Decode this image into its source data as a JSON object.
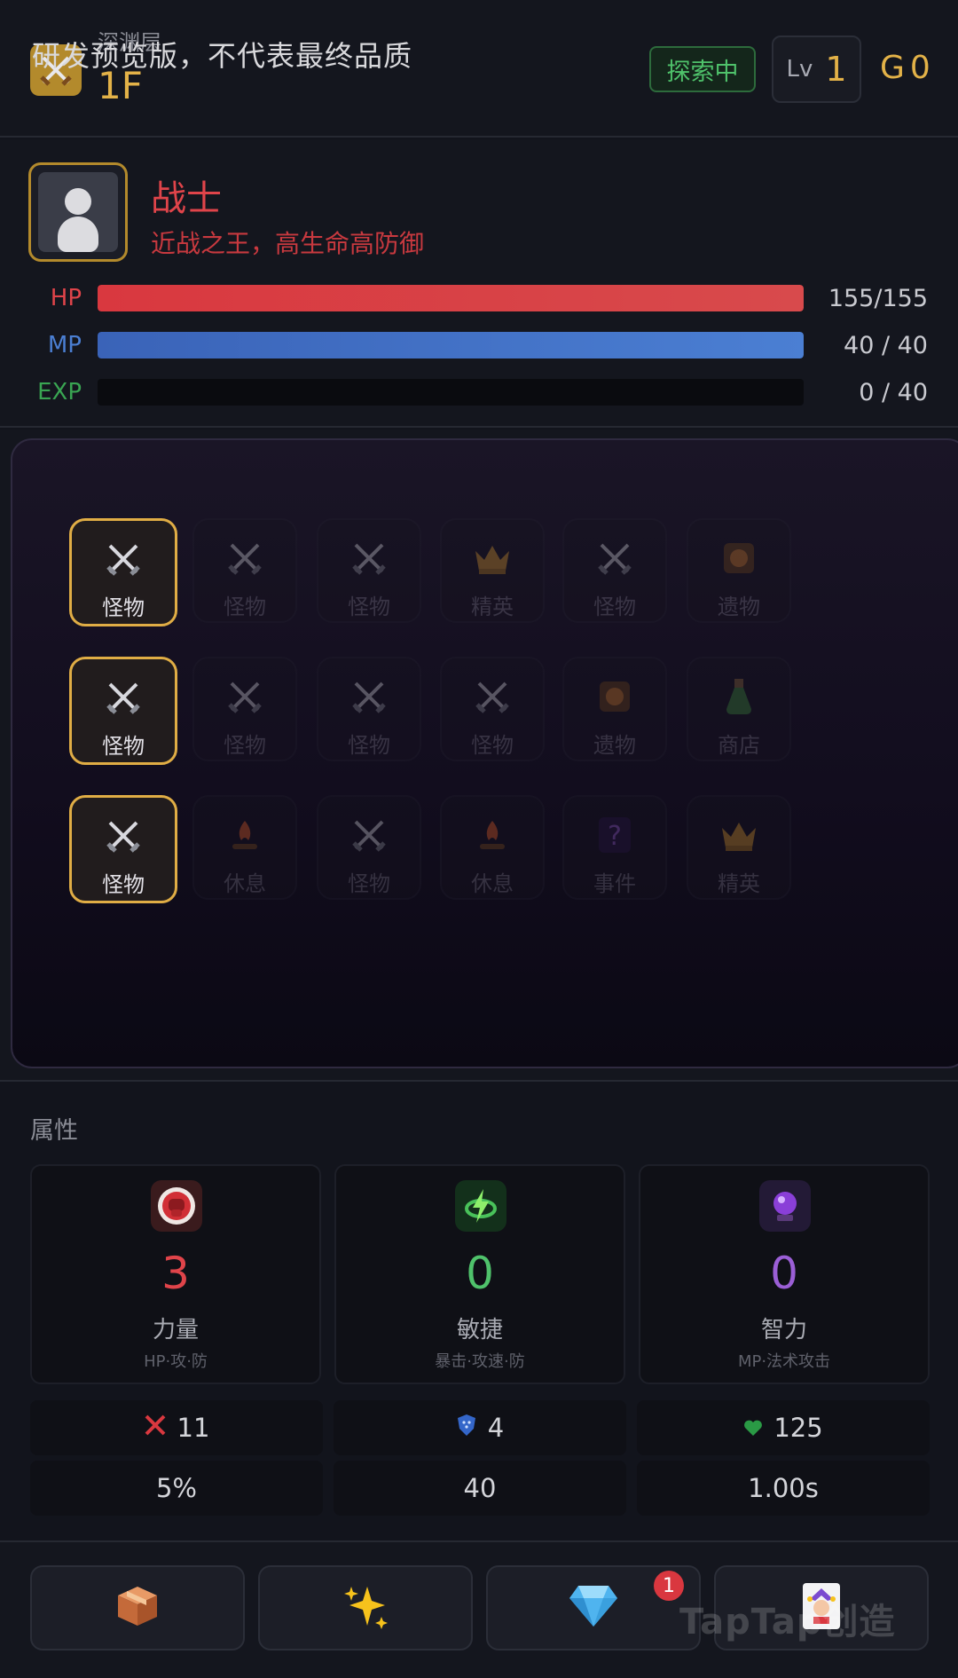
{
  "header": {
    "watermark": "研发预览版，不代表最终品质",
    "floor_sub_label": "深渊层",
    "floor_value": "1F",
    "status_badge": "探索中",
    "level_label": "Lv",
    "level_value": "1",
    "gold_label": "G",
    "gold_value": "0"
  },
  "character": {
    "class_name": "战士",
    "description": "近战之王，高生命高防御",
    "stats": [
      {
        "label": "HP",
        "value_text": "155/155",
        "current": 155,
        "max": 155,
        "color": "#d9383f",
        "color_end": "#d84a4c",
        "label_color": "#e0444a"
      },
      {
        "label": "MP",
        "value_text": "40 / 40",
        "current": 40,
        "max": 40,
        "color": "#3a63b8",
        "color_end": "#4b7fd3",
        "label_color": "#4b7fd3"
      },
      {
        "label": "EXP",
        "value_text": "0 / 40",
        "current": 0,
        "max": 40,
        "color": "#2e9a46",
        "color_end": "#2e9a46",
        "label_color": "#39a552"
      }
    ]
  },
  "map": {
    "rows": [
      [
        {
          "label": "怪物",
          "icon": "crossed-swords-icon",
          "active": true
        },
        {
          "label": "怪物",
          "icon": "crossed-swords-icon",
          "active": false
        },
        {
          "label": "怪物",
          "icon": "crossed-swords-icon",
          "active": false
        },
        {
          "label": "精英",
          "icon": "crown-icon",
          "active": false
        },
        {
          "label": "怪物",
          "icon": "crossed-swords-icon",
          "active": false
        },
        {
          "label": "遗物",
          "icon": "relic-icon",
          "active": false
        }
      ],
      [
        {
          "label": "怪物",
          "icon": "crossed-swords-icon",
          "active": true
        },
        {
          "label": "怪物",
          "icon": "crossed-swords-icon",
          "active": false
        },
        {
          "label": "怪物",
          "icon": "crossed-swords-icon",
          "active": false
        },
        {
          "label": "怪物",
          "icon": "crossed-swords-icon",
          "active": false
        },
        {
          "label": "遗物",
          "icon": "relic-icon",
          "active": false
        },
        {
          "label": "商店",
          "icon": "potion-icon",
          "active": false
        }
      ],
      [
        {
          "label": "怪物",
          "icon": "crossed-swords-icon",
          "active": true
        },
        {
          "label": "休息",
          "icon": "campfire-icon",
          "active": false
        },
        {
          "label": "怪物",
          "icon": "crossed-swords-icon",
          "active": false
        },
        {
          "label": "休息",
          "icon": "campfire-icon",
          "active": false
        },
        {
          "label": "事件",
          "icon": "question-icon",
          "active": false
        },
        {
          "label": "精英",
          "icon": "crown-icon",
          "active": false
        }
      ]
    ]
  },
  "attributes": {
    "title": "属性",
    "cards": [
      {
        "value": "3",
        "name": "力量",
        "sub": "HP·攻·防",
        "icon": "fist-icon",
        "color": "#e0444a"
      },
      {
        "value": "0",
        "name": "敏捷",
        "sub": "暴击·攻速·防",
        "icon": "lightning-icon",
        "color": "#4fc26b"
      },
      {
        "value": "0",
        "name": "智力",
        "sub": "MP·法术攻击",
        "icon": "crystal-ball-icon",
        "color": "#9b5fd6"
      }
    ],
    "row1": [
      {
        "icon": "attack-swords-icon",
        "value": "11"
      },
      {
        "icon": "shield-icon",
        "value": "4"
      },
      {
        "icon": "heart-icon",
        "value": "125"
      }
    ],
    "row2": [
      {
        "value": "5%"
      },
      {
        "value": "40"
      },
      {
        "value": "1.00s"
      }
    ]
  },
  "nav": {
    "badge_count": "1",
    "buttons": [
      {
        "icon": "package-icon"
      },
      {
        "icon": "sparkles-icon"
      },
      {
        "icon": "gem-icon"
      },
      {
        "icon": "joker-icon"
      }
    ],
    "watermark": "TapTap创造"
  }
}
